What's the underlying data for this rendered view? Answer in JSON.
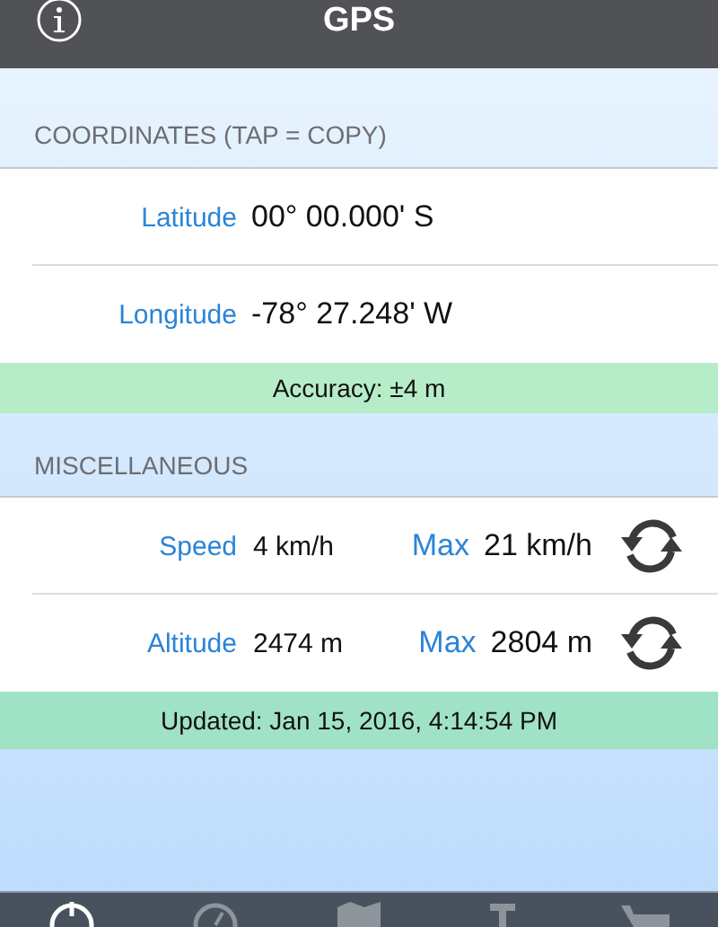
{
  "title": "GPS",
  "coordinates": {
    "header": "COORDINATES (TAP = COPY)",
    "rows": [
      {
        "label": "Latitude",
        "value": "00° 00.000' S"
      },
      {
        "label": "Longitude",
        "value": "-78° 27.248' W"
      }
    ],
    "accuracy": "Accuracy: ±4 m"
  },
  "misc": {
    "header": "MISCELLANEOUS",
    "rows": [
      {
        "label": "Speed",
        "value": "4 km/h",
        "max_label": "Max",
        "max_value": "21 km/h"
      },
      {
        "label": "Altitude",
        "value": "2474 m",
        "max_label": "Max",
        "max_value": "2804 m"
      }
    ],
    "updated": "Updated: Jan 15, 2016, 4:14:54 PM"
  },
  "tabs": [
    {
      "kind": "gps",
      "selected": true
    },
    {
      "kind": "gauge",
      "selected": false
    },
    {
      "kind": "map",
      "selected": false
    },
    {
      "kind": "tools",
      "selected": false
    },
    {
      "kind": "cart",
      "selected": false
    }
  ]
}
